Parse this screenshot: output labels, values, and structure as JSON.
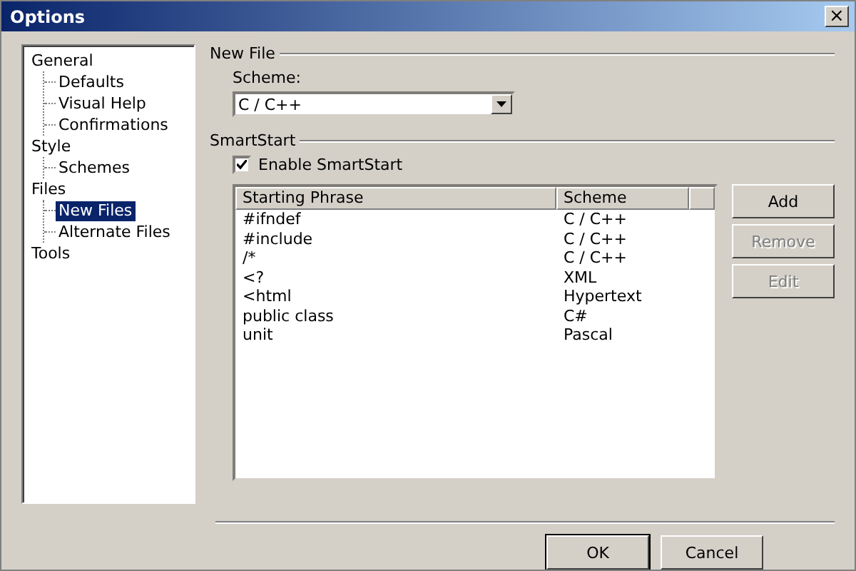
{
  "window": {
    "title": "Options",
    "close": "×"
  },
  "tree": [
    {
      "label": "General",
      "selected": false,
      "children": [
        {
          "label": "Defaults",
          "selected": false
        },
        {
          "label": "Visual Help",
          "selected": false
        },
        {
          "label": "Confirmations",
          "selected": false
        }
      ]
    },
    {
      "label": "Style",
      "selected": false,
      "children": [
        {
          "label": "Schemes",
          "selected": false
        }
      ]
    },
    {
      "label": "Files",
      "selected": false,
      "children": [
        {
          "label": "New Files",
          "selected": true
        },
        {
          "label": "Alternate Files",
          "selected": false
        }
      ]
    },
    {
      "label": "Tools",
      "selected": false
    }
  ],
  "new_file": {
    "title": "New File",
    "scheme_label": "Scheme:",
    "scheme_value": "C / C++"
  },
  "smart_start": {
    "title": "SmartStart",
    "enable_label": "Enable SmartStart",
    "checked": true,
    "columns": [
      "Starting Phrase",
      "Scheme"
    ],
    "rows": [
      [
        "#ifndef",
        "C / C++"
      ],
      [
        "#include",
        "C / C++"
      ],
      [
        "/*",
        "C / C++"
      ],
      [
        "<?",
        "XML"
      ],
      [
        "<html",
        "Hypertext"
      ],
      [
        "public class",
        "C#"
      ],
      [
        "unit",
        "Pascal"
      ]
    ],
    "buttons": [
      {
        "label": "Add",
        "disabled": false
      },
      {
        "label": "Remove",
        "disabled": true
      },
      {
        "label": "Edit",
        "disabled": true
      }
    ]
  },
  "footer_buttons": [
    {
      "label": "OK",
      "default": true
    },
    {
      "label": "Cancel",
      "default": false
    }
  ]
}
